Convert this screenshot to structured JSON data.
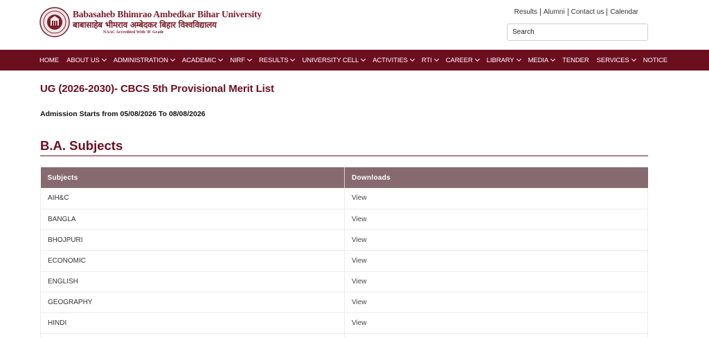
{
  "header": {
    "logo_en": "Babasaheb Bhimrao Ambedkar Bihar University",
    "logo_hi": "बाबासाहेब भीमराव अम्बेदकर बिहार विश्वविद्यालय",
    "logo_naac": "NAAC Accredited With 'B' Grade",
    "top_links": [
      "Results",
      "Alumni",
      "Contact us",
      "Calendar"
    ],
    "search_placeholder": "Search"
  },
  "nav": {
    "items": [
      {
        "label": "HOME",
        "dropdown": false
      },
      {
        "label": "ABOUT US",
        "dropdown": true
      },
      {
        "label": "ADMINISTRATION",
        "dropdown": true
      },
      {
        "label": "ACADEMIC",
        "dropdown": true
      },
      {
        "label": "NIRF",
        "dropdown": true
      },
      {
        "label": "RESULTS",
        "dropdown": true
      },
      {
        "label": "UNIVERSITY CELL",
        "dropdown": true
      },
      {
        "label": "ACTIVITIES",
        "dropdown": true
      },
      {
        "label": "RTI",
        "dropdown": true
      },
      {
        "label": "CAREER",
        "dropdown": true
      },
      {
        "label": "LIBRARY",
        "dropdown": true
      },
      {
        "label": "MEDIA",
        "dropdown": true
      },
      {
        "label": "TENDER",
        "dropdown": false
      },
      {
        "label": "SERVICES",
        "dropdown": true
      },
      {
        "label": "NOTICE",
        "dropdown": false
      }
    ]
  },
  "main": {
    "page_title": "UG (2026-2030)- CBCS 5th Provisional Merit List",
    "admission_text": "Admission Starts from 05/08/2026 To 08/08/2026",
    "section_title": "B.A. Subjects",
    "table": {
      "headers": [
        "Subjects",
        "Downloads"
      ],
      "rows": [
        {
          "subject": "AIH&C",
          "download": "View"
        },
        {
          "subject": "BANGLA",
          "download": "View"
        },
        {
          "subject": "BHOJPURI",
          "download": "View"
        },
        {
          "subject": "ECONOMIC",
          "download": "View"
        },
        {
          "subject": "ENGLISH",
          "download": "View"
        },
        {
          "subject": "GEOGRAPHY",
          "download": "View"
        },
        {
          "subject": "HINDI",
          "download": "View"
        },
        {
          "subject": "",
          "download": ""
        }
      ]
    }
  },
  "colors": {
    "brand": "#6b0e1e",
    "table_header": "#876a6f"
  }
}
